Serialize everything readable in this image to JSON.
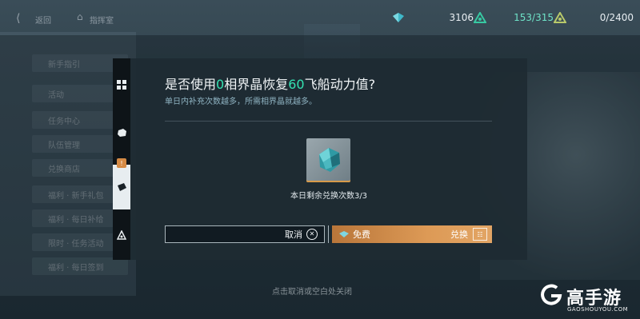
{
  "topbar": {
    "back_label": "返回",
    "sub_label": "指挥室",
    "resources": [
      {
        "name": "crystal",
        "value": "3106",
        "color": "#3fb8c9"
      },
      {
        "name": "energy",
        "value": "153/315",
        "color": "#37c9a2"
      },
      {
        "name": "points",
        "value": "0/2400",
        "color": "#b8c96a"
      }
    ]
  },
  "background": {
    "items": [
      "新手指引",
      "活动",
      "任务中心",
      "队伍管理",
      "兑换商店",
      "福利 · 新手礼包",
      "福利 · 每日补给",
      "限时 · 任务活动",
      "福利 · 每日签到"
    ]
  },
  "tabs": [
    {
      "icon": "grid-icon"
    },
    {
      "icon": "cube-icon"
    },
    {
      "icon": "card-icon",
      "active": true,
      "badge": "!"
    },
    {
      "icon": "crystal-icon"
    }
  ],
  "dialog": {
    "title_prefix": "是否使用",
    "title_num1": "0",
    "title_mid": "相界晶恢复",
    "title_num2": "60",
    "title_suffix": "飞船动力值?",
    "subtitle": "单日内补充次数越多，所需相界晶就越多。",
    "remaining": "本日剩余兑换次数3/3",
    "cancel_label": "取消",
    "free_label": "免费",
    "exchange_label": "兑换",
    "highlight_color": "#34e3b2",
    "exchange_color": "#dd9a56"
  },
  "hint": "点击取消或空白处关闭",
  "watermark": {
    "brand": "高手游",
    "url": "GAOSHOUYOU.COM"
  }
}
